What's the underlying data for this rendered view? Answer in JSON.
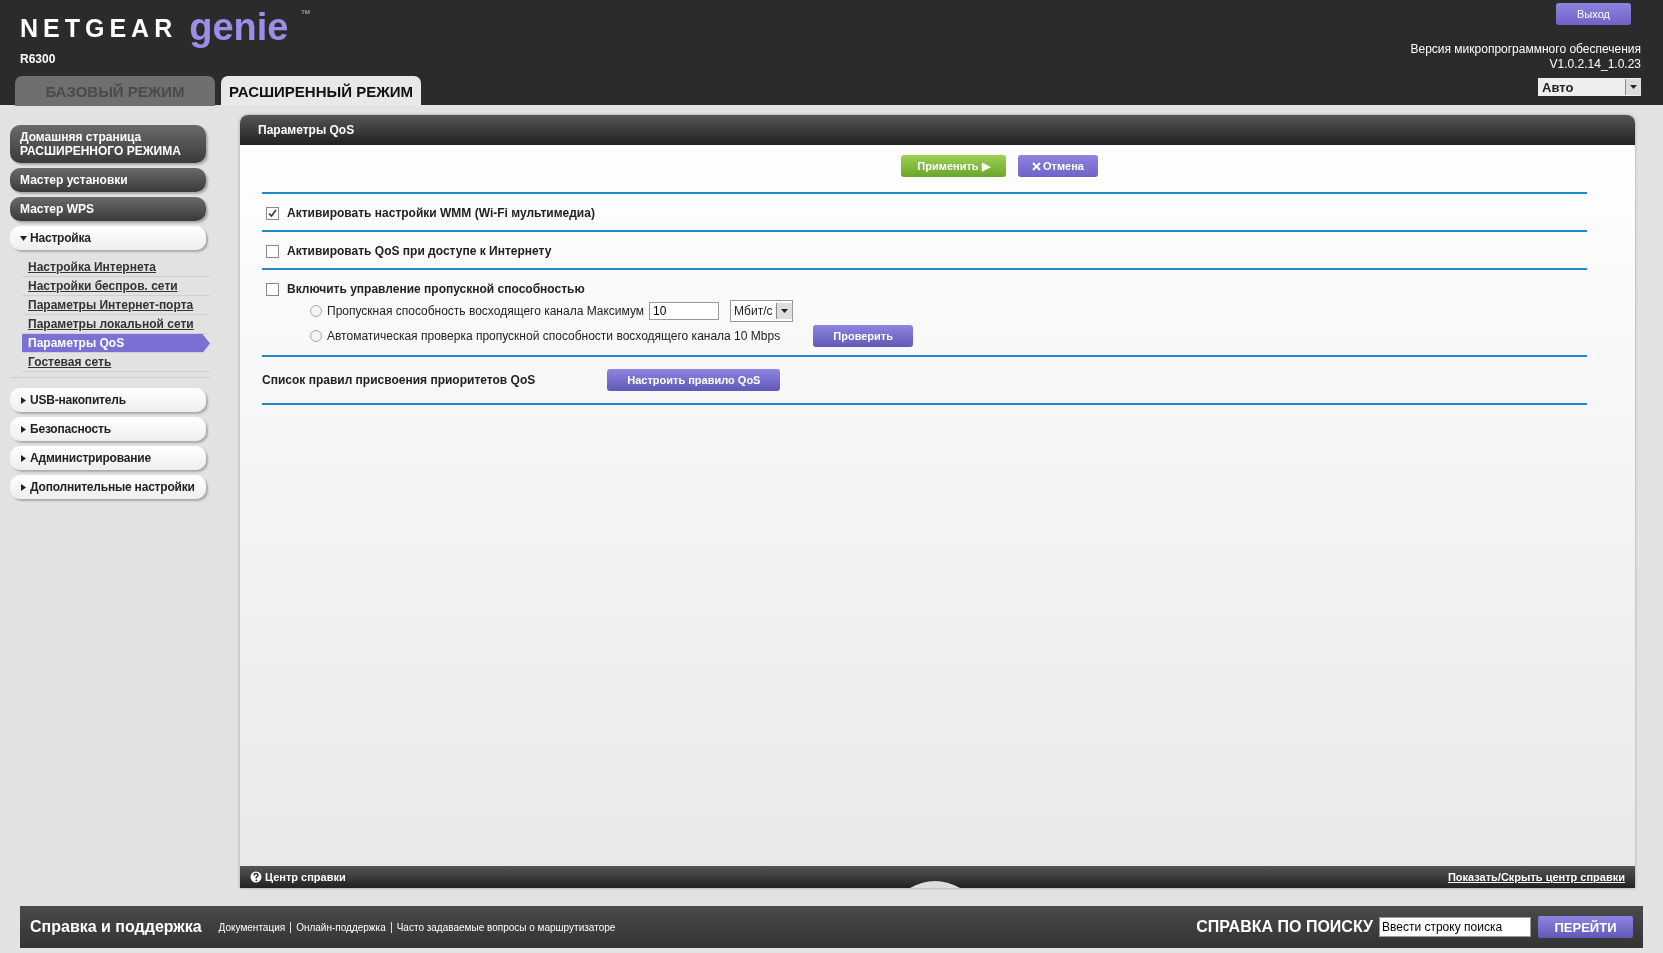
{
  "header": {
    "brand": "NETGEAR",
    "product": "genie",
    "trademark": "™",
    "model": "R6300",
    "logout_button": "Выход",
    "firmware_label": "Версия микропрограммного обеспечения",
    "firmware_version": "V1.0.2.14_1.0.23",
    "language": "Авто"
  },
  "tabs": [
    {
      "label": "БАЗОВЫЙ РЕЖИМ",
      "selected": false
    },
    {
      "label": "РАСШИРЕННЫЙ РЕЖИМ",
      "selected": true
    }
  ],
  "sidebar": {
    "items": [
      {
        "kind": "button",
        "label": "Домашняя страница РАСШИРЕННОГО РЕЖИМА"
      },
      {
        "kind": "button",
        "label": "Мастер установки"
      },
      {
        "kind": "button",
        "label": "Мастер WPS"
      },
      {
        "kind": "section",
        "label": "Настройка",
        "expanded": true,
        "children": [
          {
            "label": "Настройка Интернета",
            "selected": false
          },
          {
            "label": "Настройки беспров. сети",
            "selected": false
          },
          {
            "label": "Параметры Интернет-порта",
            "selected": false
          },
          {
            "label": "Параметры локальной сети",
            "selected": false
          },
          {
            "label": "Параметры QoS",
            "selected": true
          },
          {
            "label": "Гостевая сеть",
            "selected": false
          }
        ]
      },
      {
        "kind": "section",
        "label": "USB-накопитель",
        "expanded": false
      },
      {
        "kind": "section",
        "label": "Безопасность",
        "expanded": false
      },
      {
        "kind": "section",
        "label": "Администрирование",
        "expanded": false
      },
      {
        "kind": "section",
        "label": "Дополнительные настройки",
        "expanded": false
      }
    ]
  },
  "panel": {
    "title": "Параметры QoS",
    "apply_button": "Применить ▶",
    "cancel_button": "Отмена",
    "options": [
      {
        "label": "Активировать настройки WMM (Wi-Fi мультимедиа)",
        "checked": true
      },
      {
        "label": "Активировать QoS при доступе к Интернету",
        "checked": false
      },
      {
        "label": "Включить управление пропускной способностью",
        "checked": false
      }
    ],
    "bandwidth": {
      "manual": {
        "label": "Пропускная способность восходящего канала Максимум",
        "selected": false,
        "value": "10",
        "unit": "Мбит/с"
      },
      "auto": {
        "label": "Автоматическая проверка пропускной способности восходящего канала 10 Mbps",
        "selected": false,
        "button": "Проверить"
      }
    },
    "rules": {
      "label": "Список правил присвоения приоритетов QoS",
      "button": "Настроить правило QoS"
    }
  },
  "help_bar": {
    "title": "Центр справки",
    "toggle_link": "Показать/Скрыть центр справки"
  },
  "footer": {
    "title": "Справка и поддержка",
    "links": [
      "Документация",
      "Онлайн-поддержка",
      "Часто задаваемые вопросы о маршрутизаторе"
    ],
    "search_label": "СПРАВКА ПО ПОИСКУ",
    "search_placeholder": "Ввести строку поиска",
    "search_button": "ПЕРЕЙТИ"
  }
}
